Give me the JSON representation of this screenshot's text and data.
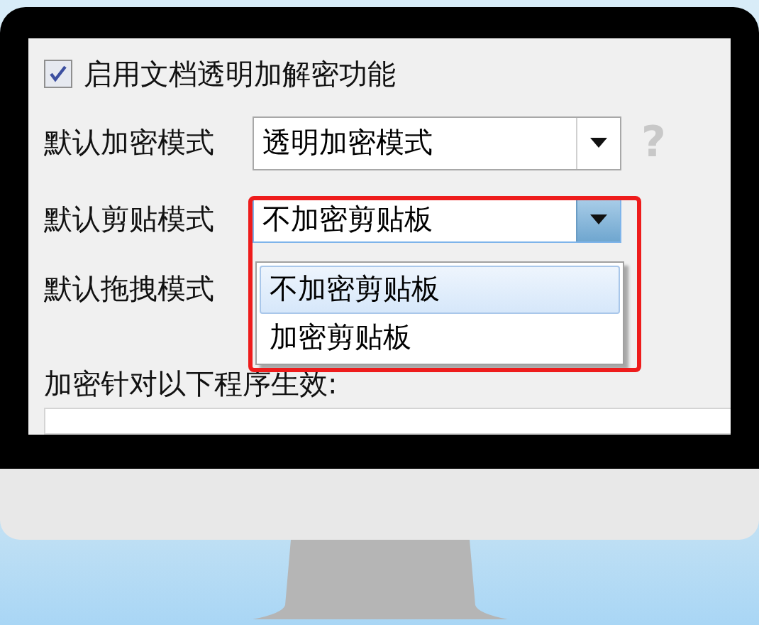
{
  "checkbox": {
    "label": "启用文档透明加解密功能",
    "checked": true
  },
  "settings": [
    {
      "label": "默认加密模式",
      "kind": "combo",
      "value": "透明加密模式",
      "focused": false,
      "help": "?"
    },
    {
      "label": "默认剪贴模式",
      "kind": "combo",
      "value": "不加密剪贴板",
      "focused": true
    },
    {
      "label": "默认拖拽模式",
      "kind": "label"
    }
  ],
  "dropdown": {
    "options": [
      {
        "label": "不加密剪贴板",
        "selected": true
      },
      {
        "label": "加密剪贴板",
        "selected": false
      }
    ]
  },
  "section_label": "加密针对以下程序生效:"
}
